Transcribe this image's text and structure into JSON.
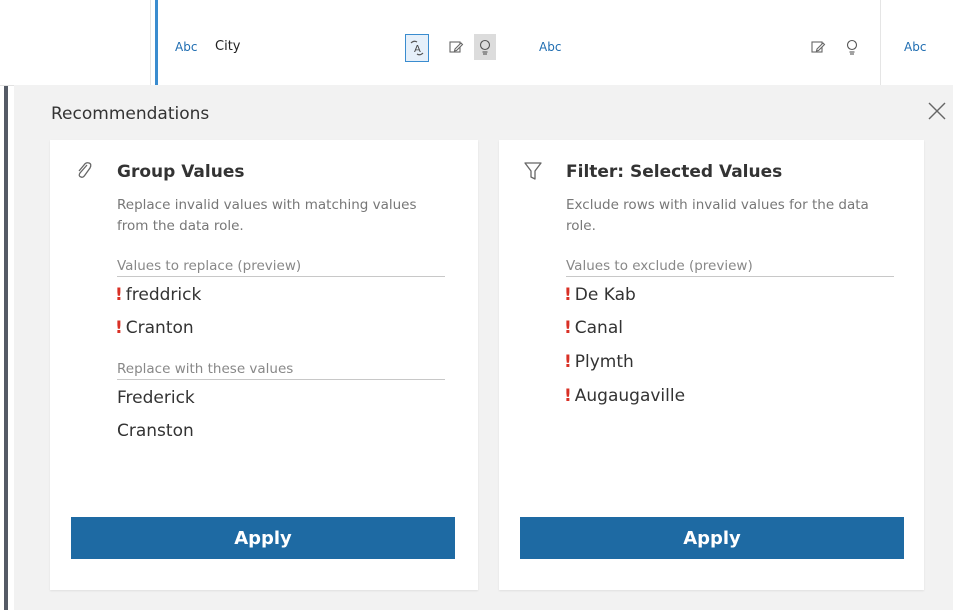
{
  "header": {
    "columns": [
      {
        "type": "Abc",
        "name": "City"
      },
      {
        "type": "Abc"
      },
      {
        "type": "Abc"
      }
    ]
  },
  "recommendations": {
    "title": "Recommendations",
    "cards": [
      {
        "icon": "paperclip-icon",
        "title": "Group Values",
        "description": "Replace invalid values with matching values from the data role.",
        "section1_label": "Values to replace (preview)",
        "values_to_replace": [
          "freddrick",
          "Cranton"
        ],
        "section2_label": "Replace with these values",
        "replacement_values": [
          "Frederick",
          "Cranston"
        ],
        "button": "Apply"
      },
      {
        "icon": "filter-icon",
        "title": "Filter: Selected Values",
        "description": "Exclude rows with invalid values for the data role.",
        "section1_label": "Values to exclude (preview)",
        "values_to_exclude": [
          "De Kab",
          "Canal",
          "Plymth",
          "Augaugaville"
        ],
        "button": "Apply"
      }
    ]
  },
  "colors": {
    "accent_blue": "#3a8ccf",
    "button_blue": "#1e6aa3",
    "invalid_red": "#d93025",
    "panel_bg": "#f2f2f2"
  }
}
